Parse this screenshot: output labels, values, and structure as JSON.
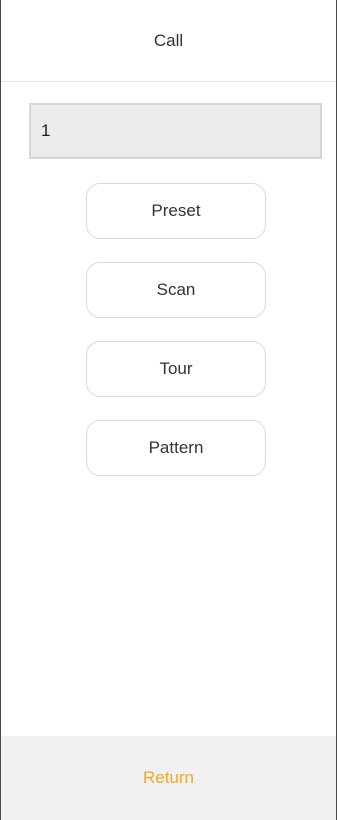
{
  "header": {
    "title": "Call"
  },
  "field": {
    "value": "1"
  },
  "buttons": {
    "preset": "Preset",
    "scan": "Scan",
    "tour": "Tour",
    "pattern": "Pattern"
  },
  "footer": {
    "return_label": "Return"
  },
  "colors": {
    "accent": "#f5a623",
    "field_bg": "#ebebeb",
    "footer_bg": "#f0f0f0"
  }
}
